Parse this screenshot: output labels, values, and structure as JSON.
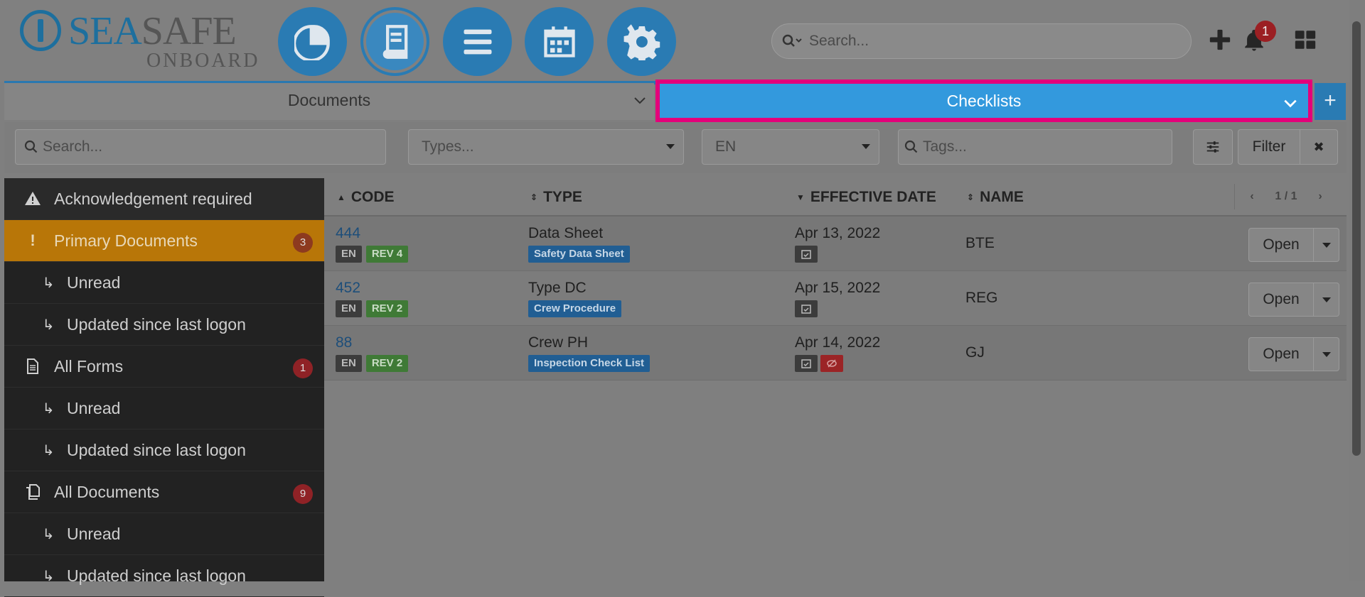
{
  "logo": {
    "sea": "SEA",
    "safe": "SAFE",
    "onboard": "ONBOARD"
  },
  "nav_buttons": [
    "dashboard-icon",
    "book-icon",
    "menu-icon",
    "calendar-icon",
    "gear-icon"
  ],
  "header": {
    "search_placeholder": "Search...",
    "notification_count": "1"
  },
  "tabs": {
    "documents": "Documents",
    "checklists": "Checklists",
    "add": "+"
  },
  "filters": {
    "search_placeholder": "Search...",
    "types_placeholder": "Types...",
    "language": "EN",
    "tags_placeholder": "Tags...",
    "filter_label": "Filter",
    "clear_label": "✖"
  },
  "sidebar": {
    "items": [
      {
        "label": "Acknowledgement required",
        "icon": "warning-icon"
      },
      {
        "label": "Primary Documents",
        "icon": "exclamation-icon",
        "badge": "3"
      },
      {
        "label": "Unread",
        "icon": "sub-arrow-icon"
      },
      {
        "label": "Updated since last logon",
        "icon": "sub-arrow-icon"
      },
      {
        "label": "All Forms",
        "icon": "file-icon",
        "badge": "1"
      },
      {
        "label": "Unread",
        "icon": "sub-arrow-icon"
      },
      {
        "label": "Updated since last logon",
        "icon": "sub-arrow-icon"
      },
      {
        "label": "All Documents",
        "icon": "documents-icon",
        "badge": "9"
      },
      {
        "label": "Unread",
        "icon": "sub-arrow-icon"
      },
      {
        "label": "Updated since last logon",
        "icon": "sub-arrow-icon"
      }
    ]
  },
  "table": {
    "headers": {
      "code": "CODE",
      "type": "TYPE",
      "effective_date": "EFFECTIVE DATE",
      "name": "NAME"
    },
    "pager": {
      "prev": "‹",
      "page": "1 / 1",
      "next": "›"
    },
    "open_label": "Open",
    "rows": [
      {
        "code": "444",
        "lang": "EN",
        "rev": "REV 4",
        "type": "Data Sheet",
        "type_tag": "Safety Data Sheet",
        "date": "Apr 13, 2022",
        "name": "BTE"
      },
      {
        "code": "452",
        "lang": "EN",
        "rev": "REV 2",
        "type": "Type DC",
        "type_tag": "Crew Procedure",
        "date": "Apr 15, 2022",
        "name": "REG"
      },
      {
        "code": "88",
        "lang": "EN",
        "rev": "REV 2",
        "type": "Crew PH",
        "type_tag": "Inspection Check List",
        "date": "Apr 14, 2022",
        "name": "GJ"
      }
    ]
  },
  "colors": {
    "brand": "#2a7bb3",
    "highlight": "#e4007a",
    "active": "#b87608"
  }
}
